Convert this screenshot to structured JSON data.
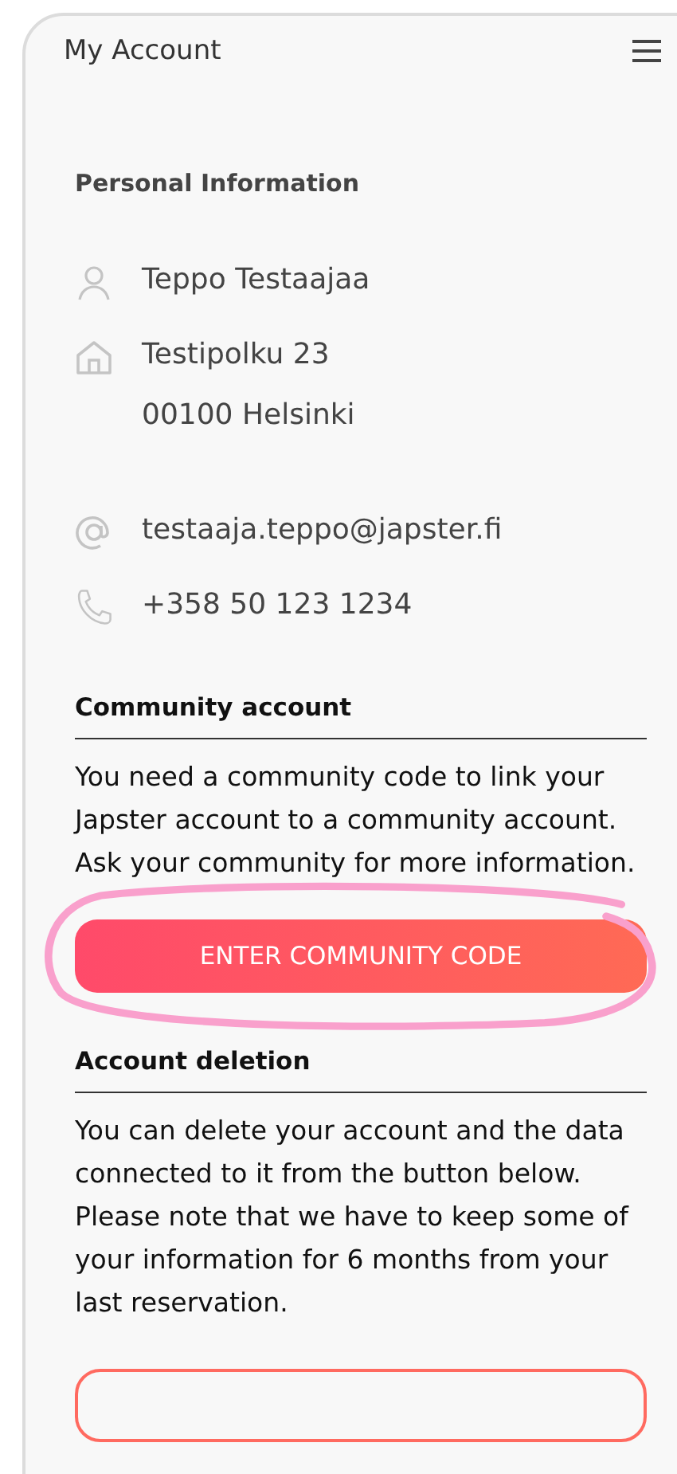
{
  "header": {
    "title": "My Account"
  },
  "personal": {
    "heading": "Personal Information",
    "rows": [
      {
        "kind": "person",
        "lines": [
          "Teppo Testaajaa"
        ]
      },
      {
        "kind": "home",
        "lines": [
          "Testipolku 23",
          "00100 Helsinki"
        ]
      },
      {
        "kind": "email",
        "lines": [
          "testaaja.teppo@japster.fi"
        ]
      },
      {
        "kind": "phone",
        "lines": [
          "+358 50 123 1234"
        ]
      }
    ]
  },
  "community": {
    "heading": "Community account",
    "text": "You need a community code to link your Japster account to a community account. Ask your community for more information.",
    "button": "ENTER COMMUNITY CODE"
  },
  "deletion": {
    "heading": "Account deletion",
    "text": "You can delete your account and the data connected to it from the button below. Please note that we have to keep some of your information for 6 months from your last reservation."
  }
}
